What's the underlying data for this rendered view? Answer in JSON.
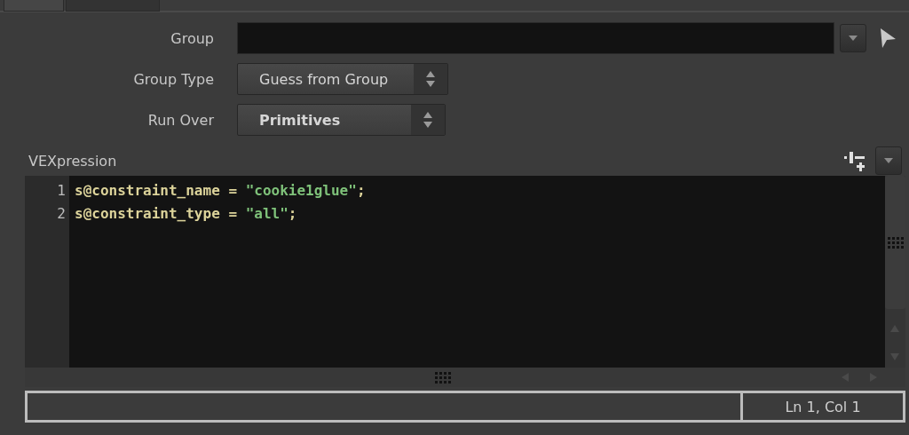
{
  "tabs": [
    {
      "selected": true
    },
    {
      "selected": false
    }
  ],
  "params": [
    {
      "label": "Group",
      "kind": "text"
    },
    {
      "label": "Group Type",
      "kind": "menu",
      "value": "Guess from Group",
      "bold": false
    },
    {
      "label": "Run Over",
      "kind": "menu",
      "value": "Primitives",
      "bold": true
    }
  ],
  "editor": {
    "label": "VEXpression",
    "lines": [
      {
        "number": "1",
        "tokens": [
          {
            "text": "s@constraint_name = ",
            "kind": "code"
          },
          {
            "text": "\"cookie1glue\"",
            "kind": "string"
          },
          {
            "text": ";",
            "kind": "code"
          }
        ]
      },
      {
        "number": "2",
        "tokens": [
          {
            "text": "s@constraint_type = ",
            "kind": "code"
          },
          {
            "text": "\"all\"",
            "kind": "string"
          },
          {
            "text": ";",
            "kind": "code"
          }
        ]
      }
    ]
  },
  "status_bar": {
    "position": "Ln 1, Col 1"
  }
}
